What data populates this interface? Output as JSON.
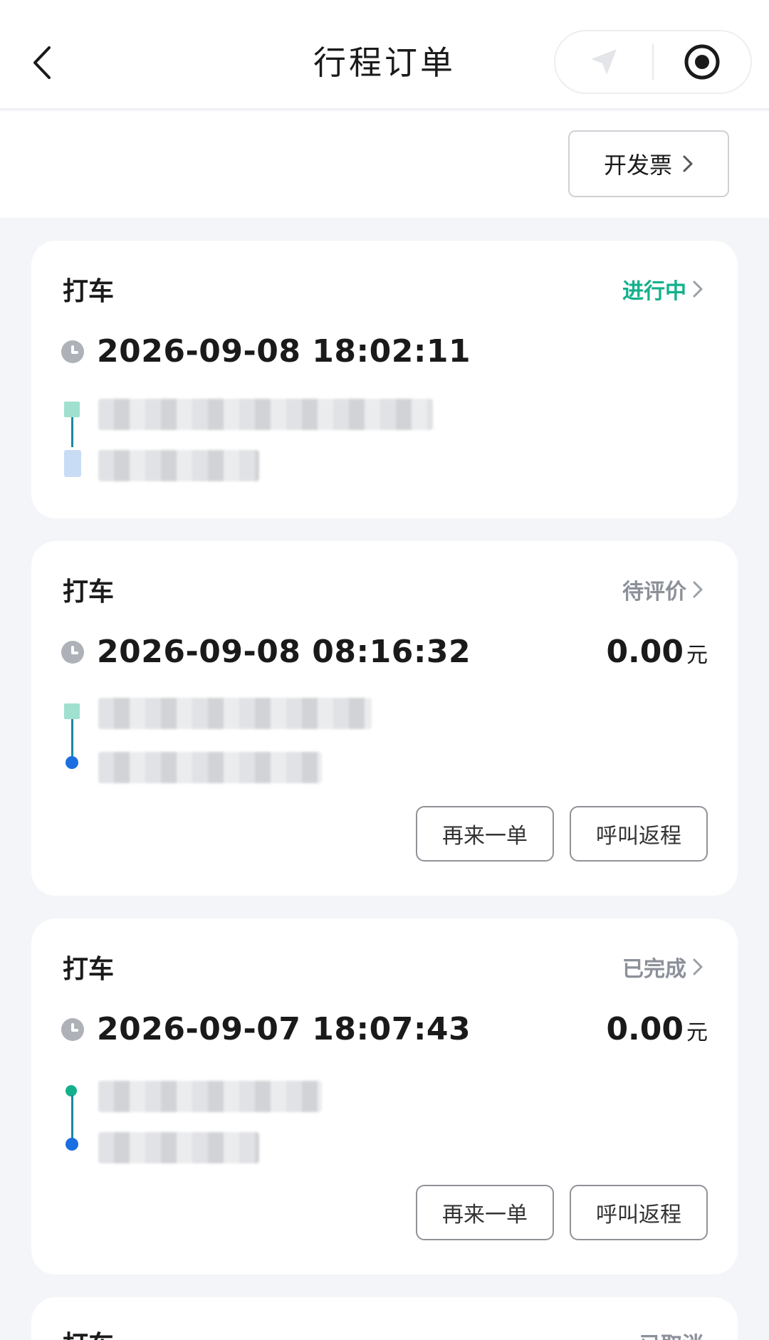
{
  "header": {
    "title": "行程订单",
    "icons": [
      "back-arrow-icon",
      "location-arrow-icon",
      "record-target-icon"
    ]
  },
  "invoice": {
    "label": "开发票"
  },
  "colors": {
    "teal": "#13b08c",
    "gray_status": "#8c9099",
    "route_line": "#1b8aa3",
    "end_blue": "#1a6ee0"
  },
  "orders": [
    {
      "type": "打车",
      "status": "进行中",
      "time": "2026-09-08 18:02:11",
      "price": "",
      "unit": ""
    },
    {
      "type": "打车",
      "status": "待评价",
      "time": "2026-09-08 08:16:32",
      "price": "0.00",
      "unit": "元",
      "actions": [
        "再来一单",
        "呼叫返程"
      ]
    },
    {
      "type": "打车",
      "status": "已完成",
      "time": "2026-09-07 18:07:43",
      "price": "0.00",
      "unit": "元",
      "actions": [
        "再来一单",
        "呼叫返程"
      ]
    },
    {
      "type": "打车",
      "status": "已取消"
    }
  ]
}
